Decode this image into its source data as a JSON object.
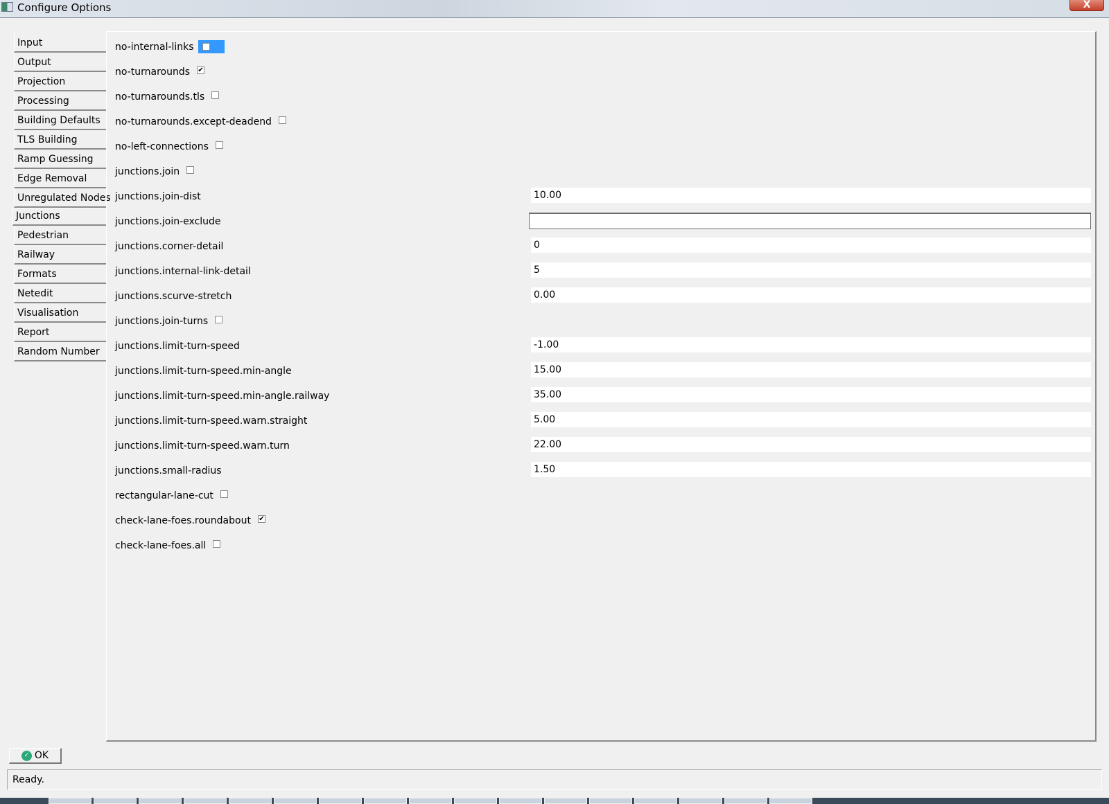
{
  "window": {
    "title": "Configure Options",
    "close_label": "X"
  },
  "sidebar": {
    "selected": "Junctions",
    "items": [
      "Input",
      "Output",
      "Projection",
      "Processing",
      "Building Defaults",
      "TLS Building",
      "Ramp Guessing",
      "Edge Removal",
      "Unregulated Nodes",
      "Junctions",
      "Pedestrian",
      "Railway",
      "Formats",
      "Netedit",
      "Visualisation",
      "Report",
      "Random Number"
    ]
  },
  "options": [
    {
      "label": "no-internal-links",
      "type": "checkbox",
      "checked": false,
      "highlighted": true
    },
    {
      "label": "no-turnarounds",
      "type": "checkbox",
      "checked": true
    },
    {
      "label": "no-turnarounds.tls",
      "type": "checkbox",
      "checked": false
    },
    {
      "label": "no-turnarounds.except-deadend",
      "type": "checkbox",
      "checked": false
    },
    {
      "label": "no-left-connections",
      "type": "checkbox",
      "checked": false
    },
    {
      "label": "junctions.join",
      "type": "checkbox",
      "checked": false
    },
    {
      "label": "junctions.join-dist",
      "type": "text",
      "value": "10.00"
    },
    {
      "label": "junctions.join-exclude",
      "type": "text",
      "value": "",
      "focused": true
    },
    {
      "label": "junctions.corner-detail",
      "type": "text",
      "value": "0"
    },
    {
      "label": "junctions.internal-link-detail",
      "type": "text",
      "value": "5"
    },
    {
      "label": "junctions.scurve-stretch",
      "type": "text",
      "value": "0.00"
    },
    {
      "label": "junctions.join-turns",
      "type": "checkbox",
      "checked": false
    },
    {
      "label": "junctions.limit-turn-speed",
      "type": "text",
      "value": "-1.00"
    },
    {
      "label": "junctions.limit-turn-speed.min-angle",
      "type": "text",
      "value": "15.00"
    },
    {
      "label": "junctions.limit-turn-speed.min-angle.railway",
      "type": "text",
      "value": "35.00"
    },
    {
      "label": "junctions.limit-turn-speed.warn.straight",
      "type": "text",
      "value": "5.00"
    },
    {
      "label": "junctions.limit-turn-speed.warn.turn",
      "type": "text",
      "value": "22.00"
    },
    {
      "label": "junctions.small-radius",
      "type": "text",
      "value": "1.50"
    },
    {
      "label": "rectangular-lane-cut",
      "type": "checkbox",
      "checked": false
    },
    {
      "label": "check-lane-foes.roundabout",
      "type": "checkbox",
      "checked": true
    },
    {
      "label": "check-lane-foes.all",
      "type": "checkbox",
      "checked": false
    }
  ],
  "ok_label": "OK",
  "status": "Ready."
}
